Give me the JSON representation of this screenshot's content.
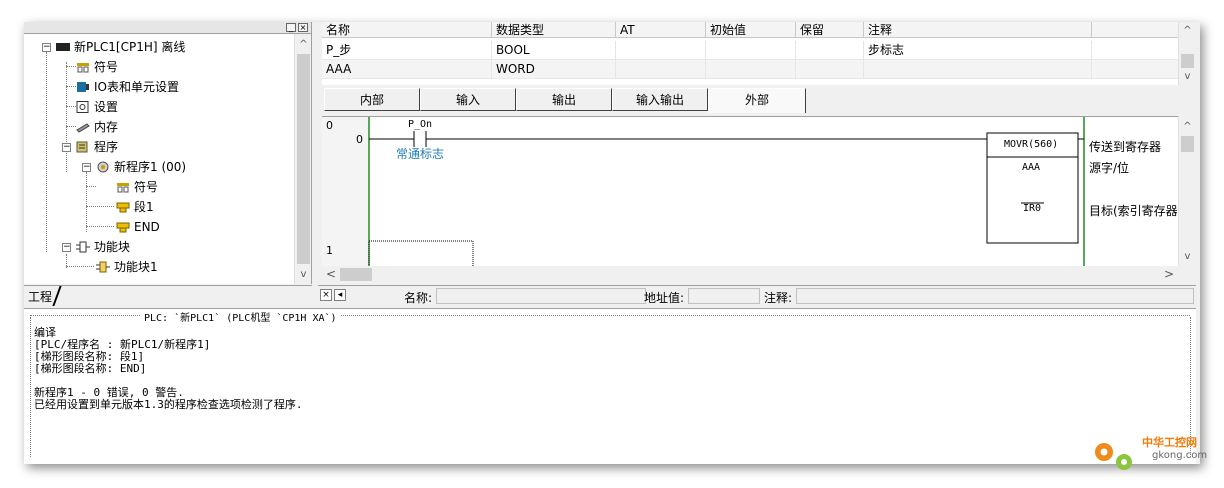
{
  "project_tree": {
    "items": [
      {
        "label": "新PLC1[CP1H] 离线",
        "icon": "plc-icon"
      },
      {
        "label": "符号",
        "icon": "symbol-icon"
      },
      {
        "label": "IO表和单元设置",
        "icon": "io-table-icon"
      },
      {
        "label": "设置",
        "icon": "settings-icon"
      },
      {
        "label": "内存",
        "icon": "memory-icon"
      },
      {
        "label": "程序",
        "icon": "programs-icon"
      },
      {
        "label": "新程序1 (00)",
        "icon": "program-icon"
      },
      {
        "label": "符号",
        "icon": "symbol-icon"
      },
      {
        "label": "段1",
        "icon": "section-icon"
      },
      {
        "label": "END",
        "icon": "section-icon"
      },
      {
        "label": "功能块",
        "icon": "function-block-icon"
      },
      {
        "label": "功能块1",
        "icon": "function-block-icon"
      }
    ],
    "tab_label": "工程"
  },
  "variable_table": {
    "headers": [
      "名称",
      "数据类型",
      "AT",
      "初始值",
      "保留",
      "注释"
    ],
    "rows": [
      {
        "name": "P_步",
        "type": "BOOL",
        "at": "",
        "initial": "",
        "retain": "",
        "comment": "步标志"
      },
      {
        "name": "AAA",
        "type": "WORD",
        "at": "",
        "initial": "",
        "retain": "",
        "comment": ""
      }
    ]
  },
  "tabs": [
    "内部",
    "输入",
    "输出",
    "输入输出",
    "外部"
  ],
  "active_tab": "外部",
  "ladder": {
    "rung0_number": "0",
    "rung0_step": "0",
    "contact_name": "P_On",
    "contact_comment": "常通标志",
    "instruction": "MOVR(560)",
    "operand1": "AAA",
    "operand2": "IR0",
    "comment_instruction": "传送到寄存器",
    "comment_operand1": "源字/位",
    "comment_operand2": "目标(索引寄存器",
    "rung1_number": "1"
  },
  "statusbar": {
    "name_label": "名称:",
    "address_label": "地址值:",
    "comment_label": "注释:"
  },
  "output": {
    "title": "PLC: `新PLC1` (PLC机型 `CP1H XA`)",
    "lines": [
      "编译",
      "[PLC/程序名 : 新PLC1/新程序1]",
      "[梯形图段名称: 段1]",
      "[梯形图段名称: END]",
      "",
      "新程序1 - 0 错误, 0 警告.",
      "已经用设置到单元版本1.3的程序检查选项检测了程序."
    ]
  },
  "watermark": {
    "brand": "中华工控网",
    "url": "gkong.com"
  },
  "colors": {
    "comment_blue": "#1f7fb6",
    "rail_green": "#1e8c1e",
    "brand_orange": "#f07b0a"
  }
}
